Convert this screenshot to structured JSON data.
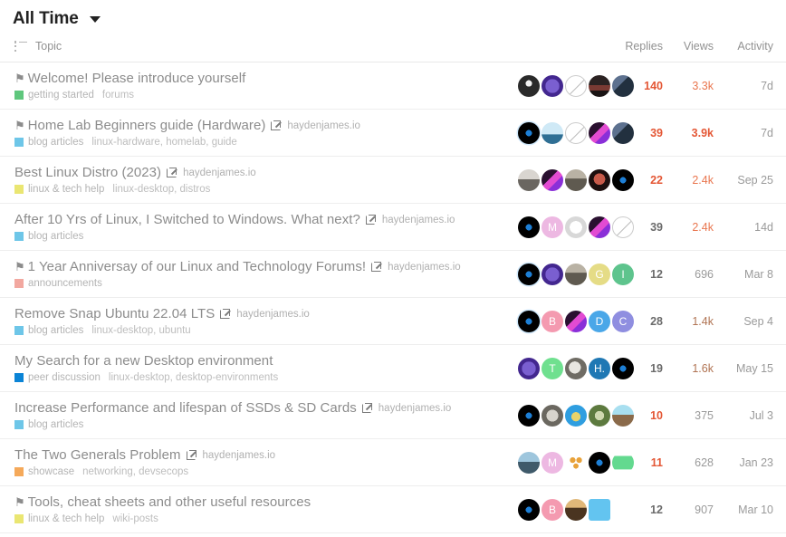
{
  "header": {
    "period_label": "All Time",
    "caret_icon": "chevron-down-icon"
  },
  "columns": {
    "topic": "Topic",
    "posters": "",
    "replies": "Replies",
    "views": "Views",
    "activity": "Activity",
    "list_icon": "list-icon"
  },
  "colors": {
    "highlight_orange": "#e45735",
    "highlight_dim": "#b07352",
    "title_grey": "#8c8c8c",
    "cat_green": "#5fc77d",
    "cat_blue": "#6ec6e8",
    "cat_yellow": "#eae672",
    "cat_red": "#f2a8a0",
    "cat_darkblue": "#0b84d6",
    "cat_orange": "#f5a councils"
  },
  "rows": [
    {
      "title": "Welcome! Please introduce yourself",
      "pin_icon": "bookmark-icon",
      "pin_glyph": "⚑",
      "external": false,
      "domain": "",
      "category": "getting started",
      "category_color": "#5fc77d",
      "tags": "forums",
      "replies": "140",
      "replies_color": "#e45735",
      "views": "3.3k",
      "views_color": "#e9764f",
      "activity": "7d",
      "posters": [
        {
          "type": "image",
          "name": "avatar-penguin",
          "bg": "#1b1b1b",
          "grad": "radial-gradient(circle at 50% 38%, #f2f2f2 0 18%, #2a2a2a 19% 100%)"
        },
        {
          "type": "image",
          "name": "avatar-purple-badge",
          "bg": "#5b3fa8",
          "grad": "radial-gradient(circle at 50% 50%, #7a5fd0 0 45%, #43278f 46% 100%)"
        },
        {
          "type": "slash",
          "name": "avatar-anonymous"
        },
        {
          "type": "image",
          "name": "avatar-dark-photo",
          "bg": "#201a1a",
          "grad": "linear-gradient(180deg,#2b2222 0 45%,#7a3a33 46% 70%,#1a1414 71% 100%)"
        },
        {
          "type": "image",
          "name": "avatar-blue-photo",
          "bg": "#394a63",
          "grad": "linear-gradient(135deg,#5d718f 0 40%,#22303f 41% 100%)"
        }
      ]
    },
    {
      "title": "Home Lab Beginners guide (Hardware)",
      "pin_icon": "pin-icon",
      "pin_glyph": "⚑",
      "external": true,
      "domain": "haydenjames.io",
      "category": "blog articles",
      "category_color": "#6ec6e8",
      "tags": "linux-hardware, homelab, guide",
      "replies": "39",
      "replies_color": "#e45735",
      "views": "3.9k",
      "views_color": "#e45735",
      "activity": "7d",
      "posters": [
        {
          "type": "image",
          "name": "avatar-hj-logo",
          "bg": "#000000",
          "grad": "radial-gradient(circle at 50% 50%, #1d7fd6 0 20%, #000 21% 100%)",
          "ring": true
        },
        {
          "type": "image",
          "name": "avatar-cartoon-man",
          "bg": "#7fc7e8",
          "grad": "linear-gradient(180deg,#cfe9f6 0 55%,#2f6f94 56% 100%)"
        },
        {
          "type": "slash",
          "name": "avatar-anonymous"
        },
        {
          "type": "image",
          "name": "avatar-neon-pink",
          "bg": "#120a1a",
          "grad": "linear-gradient(135deg,#2a1030 0 40%,#e24bd2 41% 62%,#8a2fd8 63% 100%)"
        },
        {
          "type": "image",
          "name": "avatar-blue-photo",
          "bg": "#394a63",
          "grad": "linear-gradient(135deg,#5d718f 0 40%,#22303f 41% 100%)"
        }
      ]
    },
    {
      "title": "Best Linux Distro (2023)",
      "pin_icon": "",
      "pin_glyph": "",
      "external": true,
      "domain": "haydenjames.io",
      "category": "linux & tech help",
      "category_color": "#eae672",
      "tags": "linux-desktop, distros",
      "replies": "22",
      "replies_color": "#e45735",
      "views": "2.4k",
      "views_color": "#e9764f",
      "activity": "Sep 25",
      "posters": [
        {
          "type": "image",
          "name": "avatar-grey-photo",
          "bg": "#8d8d8d",
          "grad": "linear-gradient(180deg,#d9d5d0 0 45%,#6a6660 46% 100%)"
        },
        {
          "type": "image",
          "name": "avatar-neon-pink",
          "bg": "#120a1a",
          "grad": "linear-gradient(135deg,#2a1030 0 40%,#e24bd2 41% 62%,#8a2fd8 63% 100%)"
        },
        {
          "type": "image",
          "name": "avatar-bearded-man",
          "bg": "#7d7668",
          "grad": "linear-gradient(180deg,#b9b2a4 0 42%,#5f5a50 43% 100%)"
        },
        {
          "type": "image",
          "name": "avatar-red-dark",
          "bg": "#2a1212",
          "grad": "radial-gradient(circle at 50% 45%, #c75a4a 0 35%, #1d0f0f 36% 100%)"
        },
        {
          "type": "image",
          "name": "avatar-hj-logo",
          "bg": "#000000",
          "grad": "radial-gradient(circle at 50% 50%, #1d7fd6 0 20%, #000 21% 100%)"
        }
      ]
    },
    {
      "title": "After 10 Yrs of Linux, I Switched to Windows. What next?",
      "pin_icon": "",
      "pin_glyph": "",
      "external": true,
      "domain": "haydenjames.io",
      "category": "blog articles",
      "category_color": "#6ec6e8",
      "tags": "",
      "replies": "39",
      "replies_color": "#6b6b6b",
      "views": "2.4k",
      "views_color": "#e9764f",
      "activity": "14d",
      "posters": [
        {
          "type": "image",
          "name": "avatar-hj-logo",
          "bg": "#000000",
          "grad": "radial-gradient(circle at 50% 50%, #1d7fd6 0 20%, #000 21% 100%)"
        },
        {
          "type": "letter",
          "name": "avatar-letter-m",
          "letter": "M",
          "bg": "#edb8e2"
        },
        {
          "type": "image",
          "name": "avatar-sketch",
          "bg": "#efefef",
          "grad": "radial-gradient(circle at 50% 50%, #ffffff 0 40%, #d8d8d8 41% 100%)"
        },
        {
          "type": "image",
          "name": "avatar-neon-pink",
          "bg": "#120a1a",
          "grad": "linear-gradient(135deg,#2a1030 0 40%,#e24bd2 41% 62%,#8a2fd8 63% 100%)"
        },
        {
          "type": "slash",
          "name": "avatar-anonymous"
        }
      ]
    },
    {
      "title": "1 Year Anniversay of our Linux and Technology Forums!",
      "pin_icon": "pin-icon",
      "pin_glyph": "⚑",
      "external": true,
      "domain": "haydenjames.io",
      "category": "announcements",
      "category_color": "#f2a8a0",
      "tags": "",
      "replies": "12",
      "replies_color": "#6b6b6b",
      "views": "696",
      "views_color": "#9a9a9a",
      "activity": "Mar 8",
      "posters": [
        {
          "type": "image",
          "name": "avatar-hj-logo",
          "bg": "#000000",
          "grad": "radial-gradient(circle at 50% 50%, #1d7fd6 0 20%, #000 21% 100%)",
          "ring": true
        },
        {
          "type": "image",
          "name": "avatar-purple-badge",
          "bg": "#5b3fa8",
          "grad": "radial-gradient(circle at 50% 50%, #7a5fd0 0 45%, #43278f 46% 100%)"
        },
        {
          "type": "image",
          "name": "avatar-bearded-man",
          "bg": "#7d7668",
          "grad": "linear-gradient(180deg,#b9b2a4 0 42%,#5f5a50 43% 100%)"
        },
        {
          "type": "letter",
          "name": "avatar-letter-g",
          "letter": "G",
          "bg": "#e5dc86"
        },
        {
          "type": "letter",
          "name": "avatar-letter-i",
          "letter": "I",
          "bg": "#5ec48d"
        }
      ]
    },
    {
      "title": "Remove Snap Ubuntu 22.04 LTS",
      "pin_icon": "",
      "pin_glyph": "",
      "external": true,
      "domain": "haydenjames.io",
      "category": "blog articles",
      "category_color": "#6ec6e8",
      "tags": "linux-desktop, ubuntu",
      "replies": "28",
      "replies_color": "#6b6b6b",
      "views": "1.4k",
      "views_color": "#b07352",
      "activity": "Sep 4",
      "posters": [
        {
          "type": "image",
          "name": "avatar-hj-logo",
          "bg": "#000000",
          "grad": "radial-gradient(circle at 50% 50%, #1d7fd6 0 20%, #000 21% 100%)",
          "ring": true
        },
        {
          "type": "letter",
          "name": "avatar-letter-b",
          "letter": "B",
          "bg": "#f49ab0"
        },
        {
          "type": "image",
          "name": "avatar-neon-pink",
          "bg": "#120a1a",
          "grad": "linear-gradient(135deg,#2a1030 0 40%,#e24bd2 41% 62%,#8a2fd8 63% 100%)"
        },
        {
          "type": "letter",
          "name": "avatar-letter-d",
          "letter": "D",
          "bg": "#4aa7e8"
        },
        {
          "type": "letter",
          "name": "avatar-letter-c",
          "letter": "C",
          "bg": "#8f8ee0"
        }
      ]
    },
    {
      "title": "My Search for a new Desktop environment",
      "pin_icon": "",
      "pin_glyph": "",
      "external": false,
      "domain": "",
      "category": "peer discussion",
      "category_color": "#0b84d6",
      "tags": "linux-desktop, desktop-environments",
      "replies": "19",
      "replies_color": "#6b6b6b",
      "views": "1.6k",
      "views_color": "#b07352",
      "activity": "May 15",
      "posters": [
        {
          "type": "image",
          "name": "avatar-purple-badge",
          "bg": "#5b3fa8",
          "grad": "radial-gradient(circle at 50% 50%, #7a5fd0 0 45%, #43278f 46% 100%)"
        },
        {
          "type": "letter",
          "name": "avatar-letter-t",
          "letter": "T",
          "bg": "#6fe08f"
        },
        {
          "type": "image",
          "name": "avatar-dog",
          "bg": "#9a9a92",
          "grad": "radial-gradient(circle at 45% 45%, #e8e6e0 0 35%, #6f6c64 36% 100%)"
        },
        {
          "type": "letter",
          "name": "avatar-letter-h",
          "letter": "H.",
          "bg": "#1f78b4"
        },
        {
          "type": "image",
          "name": "avatar-hj-logo",
          "bg": "#000000",
          "grad": "radial-gradient(circle at 50% 50%, #1d7fd6 0 20%, #000 21% 100%)"
        }
      ]
    },
    {
      "title": "Increase Performance and lifespan of SSDs & SD Cards",
      "pin_icon": "",
      "pin_glyph": "",
      "external": true,
      "domain": "haydenjames.io",
      "category": "blog articles",
      "category_color": "#6ec6e8",
      "tags": "",
      "replies": "10",
      "replies_color": "#e45735",
      "views": "375",
      "views_color": "#9a9a9a",
      "activity": "Jul 3",
      "posters": [
        {
          "type": "image",
          "name": "avatar-hj-logo",
          "bg": "#000000",
          "grad": "radial-gradient(circle at 50% 50%, #1d7fd6 0 20%, #000 21% 100%)"
        },
        {
          "type": "image",
          "name": "avatar-sloth",
          "bg": "#8e8e86",
          "grad": "radial-gradient(circle at 50% 50%, #d7d4cc 0 38%, #6b6860 39% 100%)"
        },
        {
          "type": "image",
          "name": "avatar-blue-cartoon",
          "bg": "#3aa7e8",
          "grad": "radial-gradient(circle at 50% 55%, #e8d36a 0 28%, #2f9ee0 29% 100%)"
        },
        {
          "type": "image",
          "name": "avatar-green-photo",
          "bg": "#6c8a4a",
          "grad": "radial-gradient(circle at 50% 50%, #cfd8b0 0 30%, #5d7a3f 31% 100%)"
        },
        {
          "type": "image",
          "name": "avatar-squirrel",
          "bg": "#8fd4e8",
          "grad": "linear-gradient(180deg,#a8dff0 0 45%,#8a6a4a 46% 100%)"
        }
      ]
    },
    {
      "title": "The Two Generals Problem",
      "pin_icon": "",
      "pin_glyph": "",
      "external": true,
      "domain": "haydenjames.io",
      "category": "showcase",
      "category_color": "#f5a95a",
      "tags": "networking, devsecops",
      "replies": "11",
      "replies_color": "#e45735",
      "views": "628",
      "views_color": "#9a9a9a",
      "activity": "Jan 23",
      "posters": [
        {
          "type": "image",
          "name": "avatar-landscape",
          "bg": "#7a9fb8",
          "grad": "linear-gradient(180deg,#9ec6dd 0 45%,#3f5a6a 46% 100%)"
        },
        {
          "type": "letter",
          "name": "avatar-letter-m",
          "letter": "M",
          "bg": "#edb8e2"
        },
        {
          "type": "image",
          "name": "avatar-dots",
          "bg": "#ffffff",
          "grad": "radial-gradient(circle at 35% 38%, #e8a23a 0 14%, transparent 15%), radial-gradient(circle at 65% 38%, #e8a23a 0 14%, transparent 15%), radial-gradient(circle at 50% 65%, #e8a23a 0 14%, transparent 15%)"
        },
        {
          "type": "image",
          "name": "avatar-hj-logo",
          "bg": "#000000",
          "grad": "radial-gradient(circle at 50% 50%, #1d7fd6 0 20%, #000 21% 100%)"
        },
        {
          "type": "image",
          "name": "avatar-green-pixel",
          "bg": "#ffffff",
          "grad": "linear-gradient(180deg,#ffffff 0 18%,#63d98f 19% 80%,#ffffff 81% 100%)"
        }
      ]
    },
    {
      "title": "Tools, cheat sheets and other useful resources",
      "pin_icon": "bookmark-icon",
      "pin_glyph": "⚑",
      "external": false,
      "domain": "",
      "category": "linux & tech help",
      "category_color": "#eae672",
      "tags": "wiki-posts",
      "replies": "12",
      "replies_color": "#6b6b6b",
      "views": "907",
      "views_color": "#9a9a9a",
      "activity": "Mar 10",
      "posters": [
        {
          "type": "image",
          "name": "avatar-hj-logo",
          "bg": "#000000",
          "grad": "radial-gradient(circle at 50% 50%, #1d7fd6 0 20%, #000 21% 100%)"
        },
        {
          "type": "letter",
          "name": "avatar-letter-b",
          "letter": "B",
          "bg": "#f49ab0"
        },
        {
          "type": "image",
          "name": "avatar-anime",
          "bg": "#c08a4a",
          "grad": "linear-gradient(180deg,#e0b87a 0 40%,#4a3420 41% 100%)"
        },
        {
          "type": "image",
          "name": "avatar-blue-square",
          "bg": "#2f9ee0",
          "grad": "linear-gradient(180deg,#63c4f0 0 100%)",
          "square": true
        }
      ]
    }
  ]
}
